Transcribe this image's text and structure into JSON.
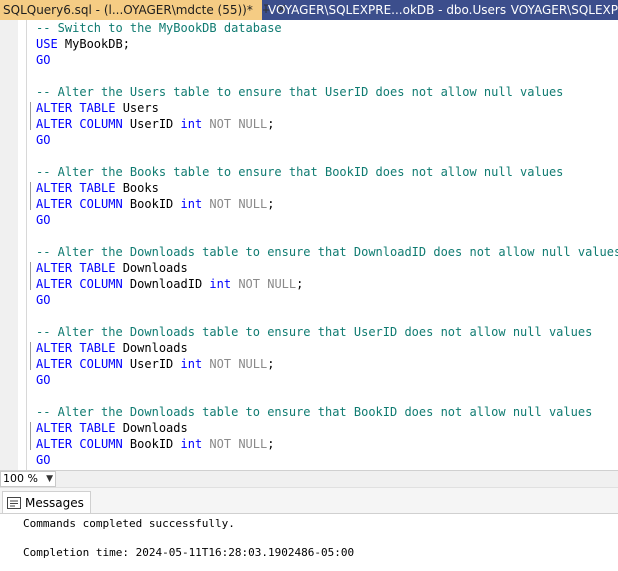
{
  "tabs": [
    {
      "label": "SQLQuery6.sql - (l...OYAGER\\mdcte (55))*",
      "active": true
    },
    {
      "label": "VOYAGER\\SQLEXPRE...okDB - dbo.Users",
      "active": false
    },
    {
      "label": "VOYAGER\\SQLEXP",
      "active": false
    }
  ],
  "tab_icons": {
    "pin": "pin-icon",
    "close": "close-icon"
  },
  "editor": {
    "lines": [
      {
        "cls": "cm",
        "text": "-- Switch to the MyBookDB database"
      },
      {
        "parts": [
          {
            "c": "kw",
            "t": "USE"
          },
          {
            "c": "",
            "t": " MyBookDB;"
          }
        ]
      },
      {
        "parts": [
          {
            "c": "kw",
            "t": "GO"
          }
        ]
      },
      {
        "text": ""
      },
      {
        "cls": "cm",
        "text": "-- Alter the Users table to ensure that UserID does not allow null values"
      },
      {
        "parts": [
          {
            "c": "kw",
            "t": "ALTER TABLE"
          },
          {
            "c": "",
            "t": " Users"
          }
        ]
      },
      {
        "parts": [
          {
            "c": "kw",
            "t": "ALTER COLUMN"
          },
          {
            "c": "",
            "t": " UserID "
          },
          {
            "c": "kw",
            "t": "int"
          },
          {
            "c": "",
            "t": " "
          },
          {
            "c": "gr",
            "t": "NOT NULL"
          },
          {
            "c": "",
            "t": ";"
          }
        ]
      },
      {
        "parts": [
          {
            "c": "kw",
            "t": "GO"
          }
        ]
      },
      {
        "text": ""
      },
      {
        "cls": "cm",
        "text": "-- Alter the Books table to ensure that BookID does not allow null values"
      },
      {
        "parts": [
          {
            "c": "kw",
            "t": "ALTER TABLE"
          },
          {
            "c": "",
            "t": " Books"
          }
        ]
      },
      {
        "parts": [
          {
            "c": "kw",
            "t": "ALTER COLUMN"
          },
          {
            "c": "",
            "t": " BookID "
          },
          {
            "c": "kw",
            "t": "int"
          },
          {
            "c": "",
            "t": " "
          },
          {
            "c": "gr",
            "t": "NOT NULL"
          },
          {
            "c": "",
            "t": ";"
          }
        ]
      },
      {
        "parts": [
          {
            "c": "kw",
            "t": "GO"
          }
        ]
      },
      {
        "text": ""
      },
      {
        "cls": "cm",
        "text": "-- Alter the Downloads table to ensure that DownloadID does not allow null values"
      },
      {
        "parts": [
          {
            "c": "kw",
            "t": "ALTER TABLE"
          },
          {
            "c": "",
            "t": " Downloads"
          }
        ]
      },
      {
        "parts": [
          {
            "c": "kw",
            "t": "ALTER COLUMN"
          },
          {
            "c": "",
            "t": " DownloadID "
          },
          {
            "c": "kw",
            "t": "int"
          },
          {
            "c": "",
            "t": " "
          },
          {
            "c": "gr",
            "t": "NOT NULL"
          },
          {
            "c": "",
            "t": ";"
          }
        ]
      },
      {
        "parts": [
          {
            "c": "kw",
            "t": "GO"
          }
        ]
      },
      {
        "text": ""
      },
      {
        "cls": "cm",
        "text": "-- Alter the Downloads table to ensure that UserID does not allow null values"
      },
      {
        "parts": [
          {
            "c": "kw",
            "t": "ALTER TABLE"
          },
          {
            "c": "",
            "t": " Downloads"
          }
        ]
      },
      {
        "parts": [
          {
            "c": "kw",
            "t": "ALTER COLUMN"
          },
          {
            "c": "",
            "t": " UserID "
          },
          {
            "c": "kw",
            "t": "int"
          },
          {
            "c": "",
            "t": " "
          },
          {
            "c": "gr",
            "t": "NOT NULL"
          },
          {
            "c": "",
            "t": ";"
          }
        ]
      },
      {
        "parts": [
          {
            "c": "kw",
            "t": "GO"
          }
        ]
      },
      {
        "text": ""
      },
      {
        "cls": "cm",
        "text": "-- Alter the Downloads table to ensure that BookID does not allow null values"
      },
      {
        "parts": [
          {
            "c": "kw",
            "t": "ALTER TABLE"
          },
          {
            "c": "",
            "t": " Downloads"
          }
        ]
      },
      {
        "parts": [
          {
            "c": "kw",
            "t": "ALTER COLUMN"
          },
          {
            "c": "",
            "t": " BookID "
          },
          {
            "c": "kw",
            "t": "int"
          },
          {
            "c": "",
            "t": " "
          },
          {
            "c": "gr",
            "t": "NOT NULL"
          },
          {
            "c": "",
            "t": ";"
          }
        ]
      },
      {
        "parts": [
          {
            "c": "kw",
            "t": "GO"
          }
        ]
      }
    ]
  },
  "zoom": {
    "value": "100 %"
  },
  "results": {
    "tab_label": "Messages",
    "tab_icon": "messages-icon",
    "lines": [
      "Commands completed successfully.",
      "",
      "Completion time: 2024-05-11T16:28:03.1902486-05:00"
    ]
  },
  "colors": {
    "tab_active": "#f5cc84",
    "tab_bar": "#3c4e8c",
    "comment": "#0f7b71",
    "keyword": "#0000ff",
    "gray": "#8a8a8a"
  }
}
